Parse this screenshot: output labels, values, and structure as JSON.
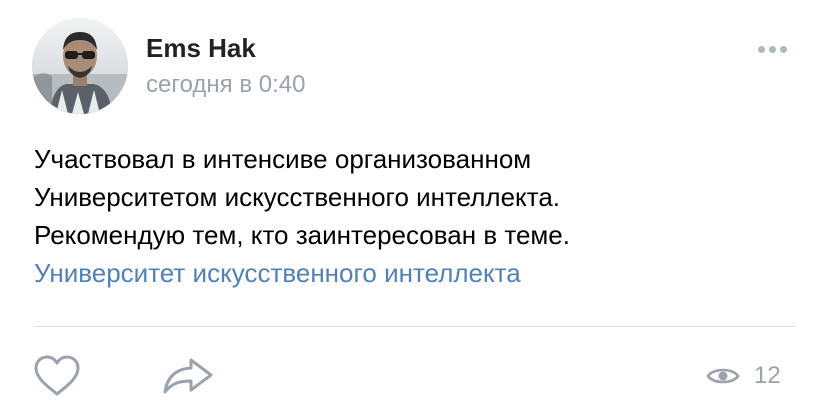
{
  "post": {
    "author": {
      "name": "Ems Hak",
      "avatar_icon": "user-avatar-photo"
    },
    "time": "сегодня в 0:40",
    "text_lines": [
      "Участвовал в интенсиве организованном",
      "Университетом искусственного интеллекта.",
      "Рекомендую тем, кто заинтересован в теме."
    ],
    "link_text": "Университет искусственного интеллекта",
    "footer": {
      "like_icon": "heart-icon",
      "share_icon": "share-arrow-icon",
      "views_icon": "eye-icon",
      "views_count": "12"
    },
    "more_icon": "more-dots-icon"
  },
  "colors": {
    "text": "#000000",
    "name": "#222222",
    "meta": "#99a2ad",
    "link": "#5181b8",
    "icon": "#99a2ad",
    "divider": "#dce1e6"
  }
}
